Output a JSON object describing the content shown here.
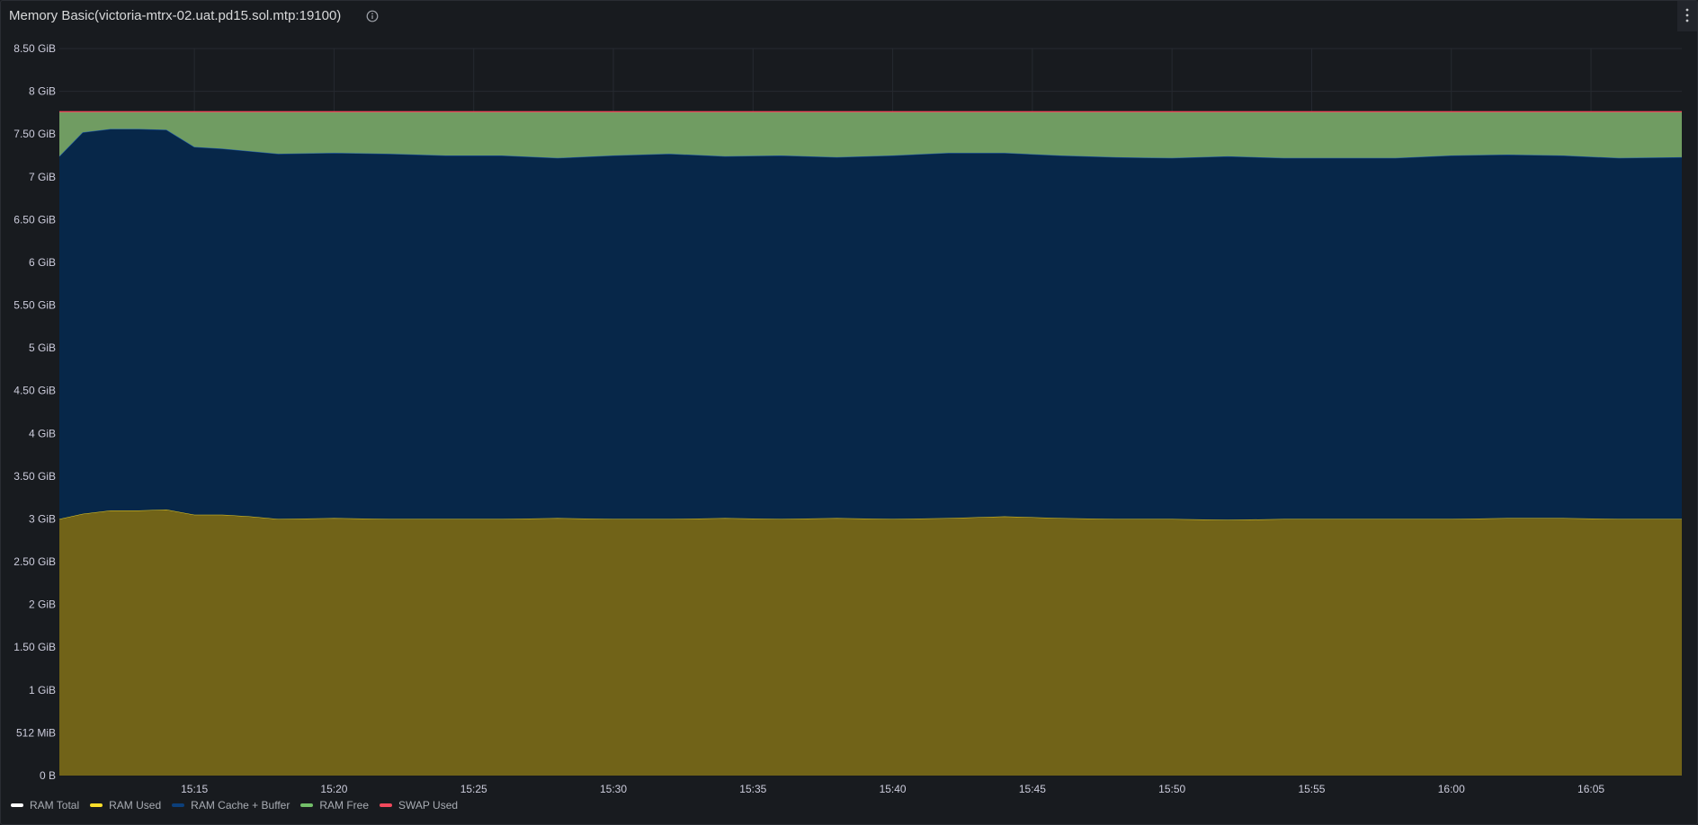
{
  "panel": {
    "title": "Memory Basic(victoria-mtrx-02.uat.pd15.sol.mtp:19100)",
    "info_icon": "info-circle-icon",
    "menu_icon": "kebab-menu-icon"
  },
  "chart_data": {
    "type": "area",
    "stacked": true,
    "y_unit": "GiB",
    "ylim": [
      0,
      8.5
    ],
    "y_ticks": [
      {
        "value": 0,
        "label": "0 B"
      },
      {
        "value": 0.5,
        "label": "512 MiB"
      },
      {
        "value": 1,
        "label": "1 GiB"
      },
      {
        "value": 1.5,
        "label": "1.50 GiB"
      },
      {
        "value": 2,
        "label": "2 GiB"
      },
      {
        "value": 2.5,
        "label": "2.50 GiB"
      },
      {
        "value": 3,
        "label": "3 GiB"
      },
      {
        "value": 3.5,
        "label": "3.50 GiB"
      },
      {
        "value": 4,
        "label": "4 GiB"
      },
      {
        "value": 4.5,
        "label": "4.50 GiB"
      },
      {
        "value": 5,
        "label": "5 GiB"
      },
      {
        "value": 5.5,
        "label": "5.50 GiB"
      },
      {
        "value": 6,
        "label": "6 GiB"
      },
      {
        "value": 6.5,
        "label": "6.50 GiB"
      },
      {
        "value": 7,
        "label": "7 GiB"
      },
      {
        "value": 7.5,
        "label": "7.50 GiB"
      },
      {
        "value": 8,
        "label": "8 GiB"
      },
      {
        "value": 8.5,
        "label": "8.50 GiB"
      }
    ],
    "x_ticks": [
      "15:15",
      "15:20",
      "15:25",
      "15:30",
      "15:35",
      "15:40",
      "15:45",
      "15:50",
      "15:55",
      "16:00",
      "16:05"
    ],
    "x_range": [
      "15:10:10",
      "16:08:15"
    ],
    "grid": true,
    "legend_position": "bottom-left",
    "x": [
      "15:10:10",
      "15:11:00",
      "15:12:00",
      "15:13:00",
      "15:14:00",
      "15:15:00",
      "15:16:00",
      "15:17:00",
      "15:18:00",
      "15:20:00",
      "15:22:00",
      "15:24:00",
      "15:26:00",
      "15:28:00",
      "15:30:00",
      "15:32:00",
      "15:34:00",
      "15:36:00",
      "15:38:00",
      "15:40:00",
      "15:42:00",
      "15:44:00",
      "15:46:00",
      "15:48:00",
      "15:50:00",
      "15:52:00",
      "15:54:00",
      "15:56:00",
      "15:58:00",
      "16:00:00",
      "16:02:00",
      "16:04:00",
      "16:06:00",
      "16:08:15"
    ],
    "series": [
      {
        "name": "RAM Total",
        "color": "#ffffff",
        "kind": "line",
        "values": [
          7.76,
          7.76,
          7.76,
          7.76,
          7.76,
          7.76,
          7.76,
          7.76,
          7.76,
          7.76,
          7.76,
          7.76,
          7.76,
          7.76,
          7.76,
          7.76,
          7.76,
          7.76,
          7.76,
          7.76,
          7.76,
          7.76,
          7.76,
          7.76,
          7.76,
          7.76,
          7.76,
          7.76,
          7.76,
          7.76,
          7.76,
          7.76,
          7.76,
          7.76
        ]
      },
      {
        "name": "RAM Used",
        "color": "#fade2a",
        "fill": "#716318",
        "kind": "stack",
        "values": [
          3.0,
          3.06,
          3.1,
          3.1,
          3.11,
          3.05,
          3.05,
          3.03,
          3.0,
          3.01,
          3.0,
          3.0,
          3.0,
          3.01,
          3.0,
          3.0,
          3.01,
          3.0,
          3.01,
          3.0,
          3.01,
          3.03,
          3.01,
          3.0,
          3.0,
          2.99,
          3.0,
          3.0,
          3.0,
          3.0,
          3.01,
          3.01,
          3.0,
          3.0
        ]
      },
      {
        "name": "RAM Cache + Buffer",
        "color": "#1f60c4",
        "fill": "#072749",
        "kind": "stack",
        "values": [
          4.24,
          4.46,
          4.46,
          4.46,
          4.44,
          4.3,
          4.28,
          4.27,
          4.27,
          4.27,
          4.27,
          4.25,
          4.25,
          4.21,
          4.25,
          4.27,
          4.23,
          4.25,
          4.22,
          4.25,
          4.27,
          4.25,
          4.24,
          4.23,
          4.22,
          4.25,
          4.22,
          4.22,
          4.22,
          4.25,
          4.25,
          4.24,
          4.22,
          4.23
        ]
      },
      {
        "name": "RAM Free",
        "color": "#73bf69",
        "fill": "#709c62",
        "kind": "stack",
        "values": [
          0.52,
          0.24,
          0.2,
          0.2,
          0.21,
          0.41,
          0.43,
          0.46,
          0.49,
          0.48,
          0.49,
          0.51,
          0.51,
          0.54,
          0.51,
          0.49,
          0.52,
          0.51,
          0.53,
          0.51,
          0.48,
          0.48,
          0.51,
          0.53,
          0.54,
          0.52,
          0.54,
          0.54,
          0.54,
          0.51,
          0.5,
          0.51,
          0.54,
          0.53
        ]
      },
      {
        "name": "SWAP Used",
        "color": "#f2495c",
        "kind": "stack",
        "values": [
          0,
          0,
          0,
          0,
          0,
          0,
          0,
          0,
          0,
          0,
          0,
          0,
          0,
          0,
          0,
          0,
          0,
          0,
          0,
          0,
          0,
          0,
          0,
          0,
          0,
          0,
          0,
          0,
          0,
          0,
          0,
          0,
          0,
          0
        ]
      }
    ]
  }
}
